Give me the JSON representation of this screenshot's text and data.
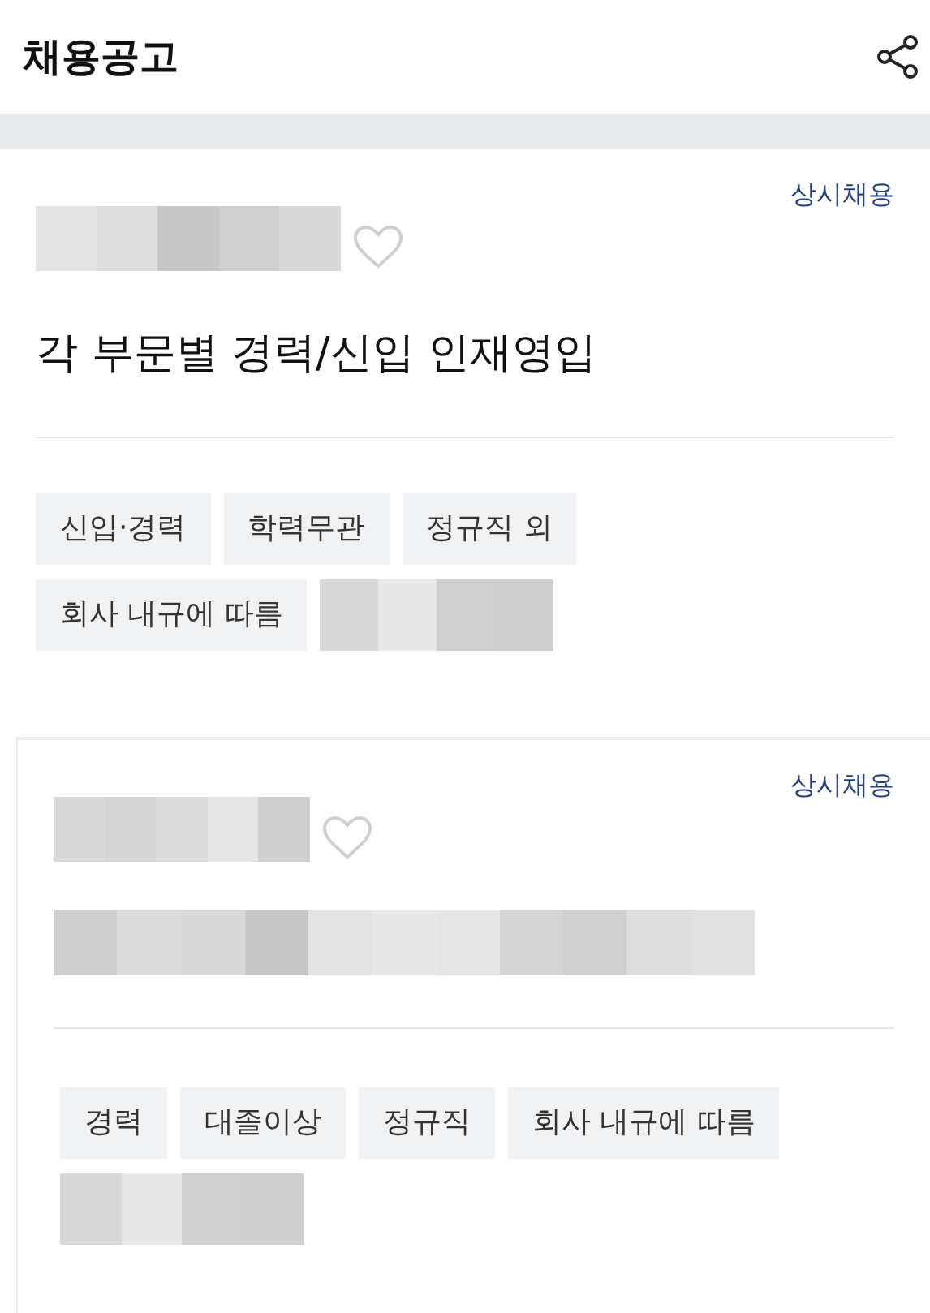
{
  "header": {
    "title": "채용공고"
  },
  "cards": [
    {
      "status": "상시채용",
      "liked": false,
      "title": {
        "kind": "text",
        "text": "각 부문별 경력/신입 인재영입"
      },
      "tags": [
        {
          "kind": "text",
          "label": "신입·경력"
        },
        {
          "kind": "text",
          "label": "학력무관"
        },
        {
          "kind": "text",
          "label": "정규직 외"
        },
        {
          "kind": "text",
          "label": "회사 내규에 따름"
        },
        {
          "kind": "blurred"
        }
      ]
    },
    {
      "status": "상시채용",
      "liked": false,
      "title": {
        "kind": "blurred"
      },
      "tags": [
        {
          "kind": "text",
          "label": "경력"
        },
        {
          "kind": "text",
          "label": "대졸이상"
        },
        {
          "kind": "text",
          "label": "정규직"
        },
        {
          "kind": "text",
          "label": "회사 내규에 따름"
        },
        {
          "kind": "blurred"
        }
      ]
    }
  ]
}
